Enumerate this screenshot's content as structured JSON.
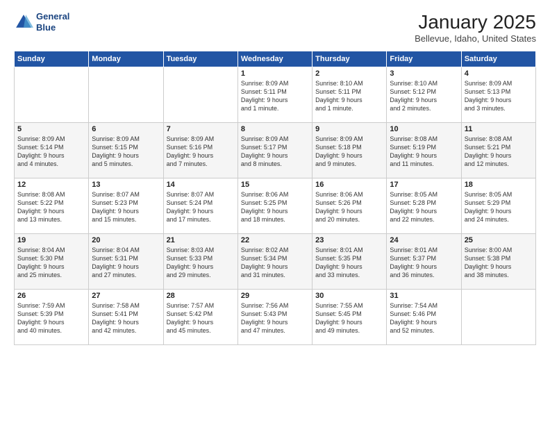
{
  "header": {
    "logo_line1": "General",
    "logo_line2": "Blue",
    "title": "January 2025",
    "subtitle": "Bellevue, Idaho, United States"
  },
  "weekdays": [
    "Sunday",
    "Monday",
    "Tuesday",
    "Wednesday",
    "Thursday",
    "Friday",
    "Saturday"
  ],
  "weeks": [
    [
      {
        "day": "",
        "info": ""
      },
      {
        "day": "",
        "info": ""
      },
      {
        "day": "",
        "info": ""
      },
      {
        "day": "1",
        "info": "Sunrise: 8:09 AM\nSunset: 5:11 PM\nDaylight: 9 hours\nand 1 minute."
      },
      {
        "day": "2",
        "info": "Sunrise: 8:10 AM\nSunset: 5:11 PM\nDaylight: 9 hours\nand 1 minute."
      },
      {
        "day": "3",
        "info": "Sunrise: 8:10 AM\nSunset: 5:12 PM\nDaylight: 9 hours\nand 2 minutes."
      },
      {
        "day": "4",
        "info": "Sunrise: 8:09 AM\nSunset: 5:13 PM\nDaylight: 9 hours\nand 3 minutes."
      }
    ],
    [
      {
        "day": "5",
        "info": "Sunrise: 8:09 AM\nSunset: 5:14 PM\nDaylight: 9 hours\nand 4 minutes."
      },
      {
        "day": "6",
        "info": "Sunrise: 8:09 AM\nSunset: 5:15 PM\nDaylight: 9 hours\nand 5 minutes."
      },
      {
        "day": "7",
        "info": "Sunrise: 8:09 AM\nSunset: 5:16 PM\nDaylight: 9 hours\nand 7 minutes."
      },
      {
        "day": "8",
        "info": "Sunrise: 8:09 AM\nSunset: 5:17 PM\nDaylight: 9 hours\nand 8 minutes."
      },
      {
        "day": "9",
        "info": "Sunrise: 8:09 AM\nSunset: 5:18 PM\nDaylight: 9 hours\nand 9 minutes."
      },
      {
        "day": "10",
        "info": "Sunrise: 8:08 AM\nSunset: 5:19 PM\nDaylight: 9 hours\nand 11 minutes."
      },
      {
        "day": "11",
        "info": "Sunrise: 8:08 AM\nSunset: 5:21 PM\nDaylight: 9 hours\nand 12 minutes."
      }
    ],
    [
      {
        "day": "12",
        "info": "Sunrise: 8:08 AM\nSunset: 5:22 PM\nDaylight: 9 hours\nand 13 minutes."
      },
      {
        "day": "13",
        "info": "Sunrise: 8:07 AM\nSunset: 5:23 PM\nDaylight: 9 hours\nand 15 minutes."
      },
      {
        "day": "14",
        "info": "Sunrise: 8:07 AM\nSunset: 5:24 PM\nDaylight: 9 hours\nand 17 minutes."
      },
      {
        "day": "15",
        "info": "Sunrise: 8:06 AM\nSunset: 5:25 PM\nDaylight: 9 hours\nand 18 minutes."
      },
      {
        "day": "16",
        "info": "Sunrise: 8:06 AM\nSunset: 5:26 PM\nDaylight: 9 hours\nand 20 minutes."
      },
      {
        "day": "17",
        "info": "Sunrise: 8:05 AM\nSunset: 5:28 PM\nDaylight: 9 hours\nand 22 minutes."
      },
      {
        "day": "18",
        "info": "Sunrise: 8:05 AM\nSunset: 5:29 PM\nDaylight: 9 hours\nand 24 minutes."
      }
    ],
    [
      {
        "day": "19",
        "info": "Sunrise: 8:04 AM\nSunset: 5:30 PM\nDaylight: 9 hours\nand 25 minutes."
      },
      {
        "day": "20",
        "info": "Sunrise: 8:04 AM\nSunset: 5:31 PM\nDaylight: 9 hours\nand 27 minutes."
      },
      {
        "day": "21",
        "info": "Sunrise: 8:03 AM\nSunset: 5:33 PM\nDaylight: 9 hours\nand 29 minutes."
      },
      {
        "day": "22",
        "info": "Sunrise: 8:02 AM\nSunset: 5:34 PM\nDaylight: 9 hours\nand 31 minutes."
      },
      {
        "day": "23",
        "info": "Sunrise: 8:01 AM\nSunset: 5:35 PM\nDaylight: 9 hours\nand 33 minutes."
      },
      {
        "day": "24",
        "info": "Sunrise: 8:01 AM\nSunset: 5:37 PM\nDaylight: 9 hours\nand 36 minutes."
      },
      {
        "day": "25",
        "info": "Sunrise: 8:00 AM\nSunset: 5:38 PM\nDaylight: 9 hours\nand 38 minutes."
      }
    ],
    [
      {
        "day": "26",
        "info": "Sunrise: 7:59 AM\nSunset: 5:39 PM\nDaylight: 9 hours\nand 40 minutes."
      },
      {
        "day": "27",
        "info": "Sunrise: 7:58 AM\nSunset: 5:41 PM\nDaylight: 9 hours\nand 42 minutes."
      },
      {
        "day": "28",
        "info": "Sunrise: 7:57 AM\nSunset: 5:42 PM\nDaylight: 9 hours\nand 45 minutes."
      },
      {
        "day": "29",
        "info": "Sunrise: 7:56 AM\nSunset: 5:43 PM\nDaylight: 9 hours\nand 47 minutes."
      },
      {
        "day": "30",
        "info": "Sunrise: 7:55 AM\nSunset: 5:45 PM\nDaylight: 9 hours\nand 49 minutes."
      },
      {
        "day": "31",
        "info": "Sunrise: 7:54 AM\nSunset: 5:46 PM\nDaylight: 9 hours\nand 52 minutes."
      },
      {
        "day": "",
        "info": ""
      }
    ]
  ]
}
